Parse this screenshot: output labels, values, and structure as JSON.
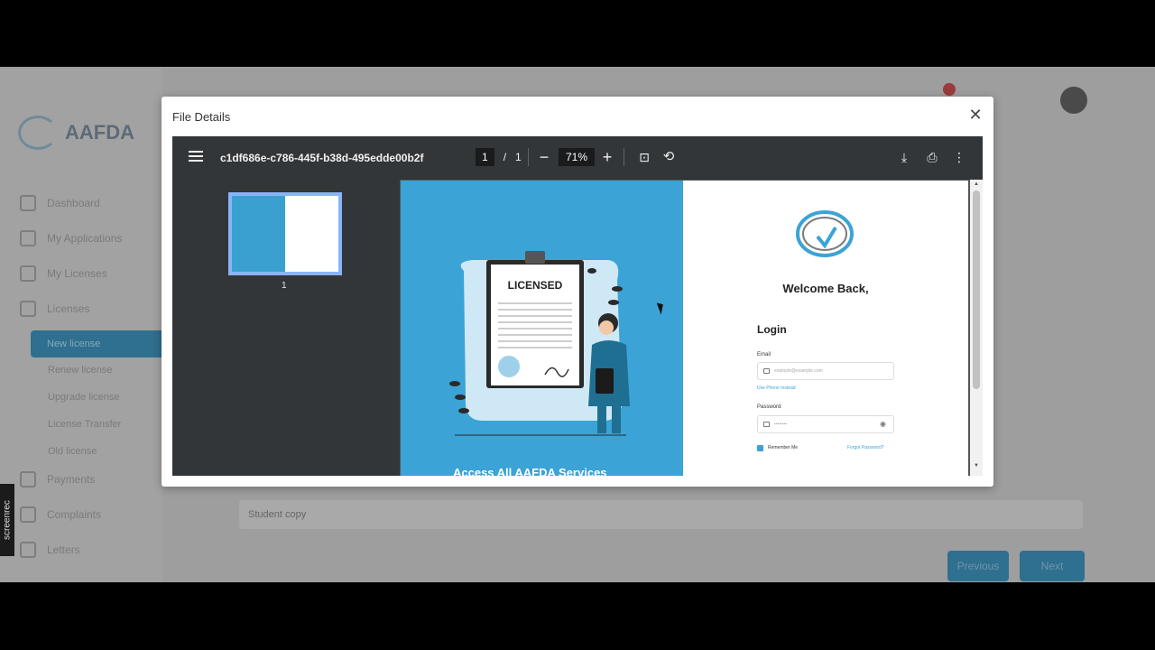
{
  "app": {
    "brand": "AAFDA",
    "nav": [
      {
        "label": "Dashboard"
      },
      {
        "label": "My Applications"
      },
      {
        "label": "My Licenses"
      },
      {
        "label": "Licenses"
      }
    ],
    "nav_sub": [
      {
        "label": "New license"
      },
      {
        "label": "Renew license"
      },
      {
        "label": "Upgrade license"
      },
      {
        "label": "License Transfer"
      },
      {
        "label": "Old license"
      }
    ],
    "nav_bottom": [
      {
        "label": "Payments"
      },
      {
        "label": "Complaints"
      },
      {
        "label": "Letters"
      }
    ],
    "row_label": "Student copy",
    "previous_label": "Previous",
    "next_label": "Next",
    "screenrec_label": "screenrec"
  },
  "modal": {
    "title": "File Details",
    "close_icon": "close-icon"
  },
  "viewer": {
    "filename": "c1df686e-c786-445f-b38d-495edde00b2f",
    "page_current": "1",
    "page_separator": "/",
    "page_total": "1",
    "zoom": "71%",
    "thumbnail_number": "1"
  },
  "document": {
    "licensed_label": "LICENSED",
    "access_text": "Access All AAFDA Services",
    "welcome": "Welcome Back,",
    "login_heading": "Login",
    "email_label": "Email",
    "email_placeholder": "example@example.com",
    "use_phone": "Use Phone Instead",
    "password_label": "Password",
    "password_value": "••••••••",
    "remember_me": "Remember Me",
    "forgot_password": "Forgot Password?"
  },
  "colors": {
    "toolbar": "#323639",
    "accent": "#3ba3d5",
    "thumb_border": "#8ab4f8"
  }
}
